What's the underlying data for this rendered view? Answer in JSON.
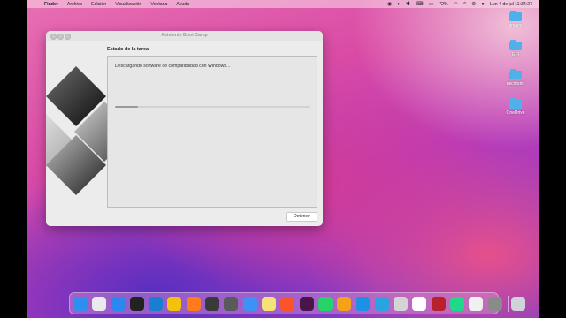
{
  "menubar": {
    "apple_glyph": "",
    "app_name": "Finder",
    "menus": [
      "Archivo",
      "Edición",
      "Visualización",
      "Ventana",
      "Ayuda"
    ],
    "battery": "72%",
    "datetime": "Lun 4 de jul  11:34:27"
  },
  "desktop": {
    "icons": [
      {
        "label": "drivers"
      },
      {
        "label": "EFI"
      },
      {
        "label": "escritorio"
      },
      {
        "label": "OneDrive"
      }
    ]
  },
  "window": {
    "title": "Asistente Boot Camp",
    "task_heading": "Estado de la tarea",
    "status": "Descargando software de compatibilidad con Windows...",
    "progress": 0.12,
    "stop_label": "Detener"
  },
  "dock": {
    "apps": [
      {
        "name": "finder",
        "color": "#2f8ff0"
      },
      {
        "name": "launchpad",
        "color": "#e9e9ee"
      },
      {
        "name": "safari",
        "color": "#2a88f0"
      },
      {
        "name": "terminal",
        "color": "#222222"
      },
      {
        "name": "visual-studio-code",
        "color": "#1a7fd0"
      },
      {
        "name": "chrome",
        "color": "#f4c20d"
      },
      {
        "name": "firefox",
        "color": "#ff7b1c"
      },
      {
        "name": "sublime-text",
        "color": "#3a3a3a"
      },
      {
        "name": "proxyman",
        "color": "#5a5a5a"
      },
      {
        "name": "mail",
        "color": "#3d93f5"
      },
      {
        "name": "notes",
        "color": "#f6e27a"
      },
      {
        "name": "brave",
        "color": "#fb542b"
      },
      {
        "name": "slack",
        "color": "#4a154b"
      },
      {
        "name": "whatsapp",
        "color": "#25d366"
      },
      {
        "name": "amphetamine",
        "color": "#f4a21a"
      },
      {
        "name": "docker",
        "color": "#1d91e6"
      },
      {
        "name": "telegram",
        "color": "#2aa3e0"
      },
      {
        "name": "parallels",
        "color": "#d4d4d4"
      },
      {
        "name": "vmware",
        "color": "#ffffff"
      },
      {
        "name": "filezilla",
        "color": "#b8202a"
      },
      {
        "name": "pycharm",
        "color": "#21d789"
      },
      {
        "name": "virtualbox",
        "color": "#f0f0f0"
      },
      {
        "name": "system-preferences",
        "color": "#8a8a8a"
      }
    ],
    "trash": {
      "name": "trash",
      "color": "#d0d4da"
    }
  }
}
